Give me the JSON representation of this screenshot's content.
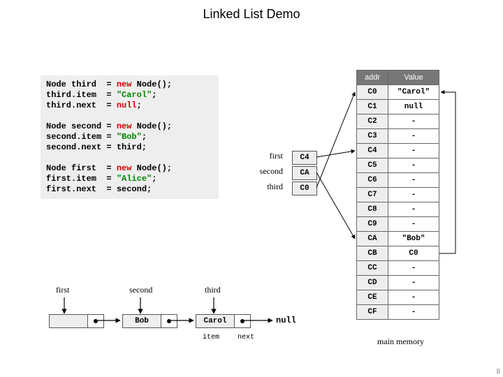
{
  "title": "Linked List Demo",
  "code": {
    "l1a": "Node third  ",
    "l1b": " new ",
    "l1c": "Node",
    "l1d": "();",
    "l2a": "third.item  ",
    "l2b": "\"Carol\"",
    "l2c": ";",
    "l3a": "third.next  ",
    "l3b": "null",
    "l3c": ";",
    "l4a": "Node second ",
    "l4b": " new ",
    "l4c": "Node",
    "l4d": "();",
    "l5a": "second.item ",
    "l5b": "\"Bob\"",
    "l5c": ";",
    "l6a": "second.next ",
    "l6b": "third;",
    "l7a": "Node first  ",
    "l7b": " new ",
    "l7c": "Node",
    "l7d": "();",
    "l8a": "first.item  ",
    "l8b": "\"Alice\"",
    "l8c": ";",
    "l9a": "first.next  ",
    "l9b": "second;"
  },
  "ptrs": {
    "first": {
      "label": "first",
      "value": "C4"
    },
    "second": {
      "label": "second",
      "value": "CA"
    },
    "third": {
      "label": "third",
      "value": "C0"
    }
  },
  "mem": {
    "h_addr": "addr",
    "h_val": "Value",
    "rows": [
      {
        "addr": "C0",
        "val": "\"Carol\""
      },
      {
        "addr": "C1",
        "val": "null"
      },
      {
        "addr": "C2",
        "val": "-"
      },
      {
        "addr": "C3",
        "val": "-"
      },
      {
        "addr": "C4",
        "val": "-"
      },
      {
        "addr": "C5",
        "val": "-"
      },
      {
        "addr": "C6",
        "val": "-"
      },
      {
        "addr": "C7",
        "val": "-"
      },
      {
        "addr": "C8",
        "val": "-"
      },
      {
        "addr": "C9",
        "val": "-"
      },
      {
        "addr": "CA",
        "val": "\"Bob\""
      },
      {
        "addr": "CB",
        "val": "C0"
      },
      {
        "addr": "CC",
        "val": "-"
      },
      {
        "addr": "CD",
        "val": "-"
      },
      {
        "addr": "CE",
        "val": "-"
      },
      {
        "addr": "CF",
        "val": "-"
      }
    ],
    "caption": "main memory"
  },
  "diagram": {
    "first_label": "first",
    "second_label": "second",
    "third_label": "third",
    "first_item": "",
    "second_item": "Bob",
    "third_item": "Carol",
    "null_label": "null",
    "item_caption": "item",
    "next_caption": "next"
  },
  "pagenum": "8"
}
